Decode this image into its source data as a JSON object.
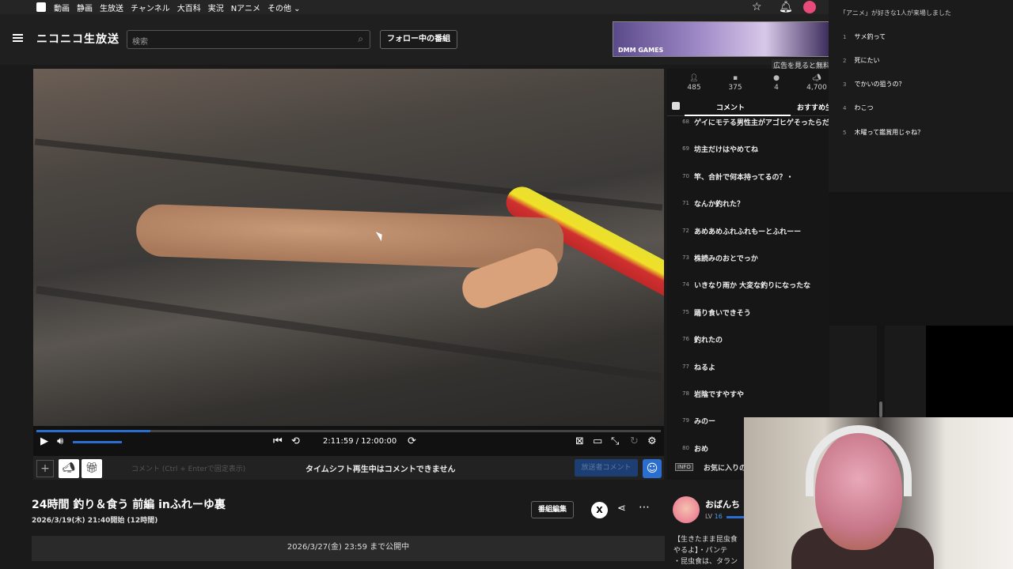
{
  "global_bar": {
    "links": [
      "動画",
      "静画",
      "生放送",
      "チャンネル",
      "大百科",
      "実況",
      "Nアニメ",
      "その他"
    ],
    "more_chevron": "chevron-down-icon"
  },
  "header": {
    "logo": "ニコニコ生放送",
    "search_placeholder": "検索",
    "follow_button": "フォロー中の番組",
    "ad_note": "広告を見ると無料"
  },
  "ad": {
    "label": "DMM GAMES"
  },
  "player": {
    "time": "2:11:59 / 12:00:00",
    "progress": 0.183,
    "volume": 0.55
  },
  "comment_input": {
    "placeholder": "コメント (Ctrl + Enterで固定表示)",
    "disabled_message": "タイムシフト再生中はコメントできません",
    "send_label": "放送者コメント"
  },
  "program": {
    "title": "24時間 釣り＆食う 前編 inふれーゆ裏",
    "date": "2026/3/19(木) 21:40開始 (12時間)",
    "edit_button": "番組編集",
    "x_label": "X",
    "available_until": "2026/3/27(金) 23:59 まで公開中"
  },
  "stats": [
    {
      "icon": "viewer-icon",
      "value": "485"
    },
    {
      "icon": "comment-icon",
      "value": "375"
    },
    {
      "icon": "ad-icon",
      "value": "4"
    },
    {
      "icon": "gift-icon",
      "value": "4,700"
    }
  ],
  "tabs": {
    "comment": "コメント",
    "recommend": "おすすめ生"
  },
  "comments": [
    {
      "no": "68",
      "text": "ゲイにモテる男性主がアゴヒゲそったらだれ"
    },
    {
      "no": "69",
      "text": "坊主だけはやめてね"
    },
    {
      "no": "70",
      "text": "竿、合計で何本持ってるの？・"
    },
    {
      "no": "71",
      "text": "なんか釣れた？"
    },
    {
      "no": "72",
      "text": "あめあめふれふれもーとふれーー"
    },
    {
      "no": "73",
      "text": "株読みのおとでっか"
    },
    {
      "no": "74",
      "text": "いきなり雨か 大変な釣りになったな"
    },
    {
      "no": "75",
      "text": "踊り食いできそう"
    },
    {
      "no": "76",
      "text": "釣れたの"
    },
    {
      "no": "77",
      "text": "ねるよ"
    },
    {
      "no": "78",
      "text": "岩陰ですやすや"
    },
    {
      "no": "79",
      "text": "みのー"
    },
    {
      "no": "80",
      "text": "おめ"
    }
  ],
  "info": {
    "tag": "INFO",
    "text": "お気に入りの"
  },
  "broadcaster": {
    "name": "おばんち",
    "level_label": "LV",
    "level": "16",
    "description_lines": [
      "【生きたまま昆虫食",
      "やるよ】・パンテ",
      "・昆虫食は、タラン"
    ]
  },
  "overlay": {
    "header": "「アニメ」が好きな1人が来場しました",
    "items": [
      {
        "no": "1",
        "text": "サメ釣って"
      },
      {
        "no": "2",
        "text": "死にたい"
      },
      {
        "no": "3",
        "text": "でかいの狙うの？"
      },
      {
        "no": "4",
        "text": "わこつ"
      },
      {
        "no": "5",
        "text": "木曜って鑑賞用じゃね？"
      }
    ]
  },
  "colors": {
    "accent": "#2a6ecf",
    "background": "#1a1a1a",
    "panel": "#161616"
  }
}
